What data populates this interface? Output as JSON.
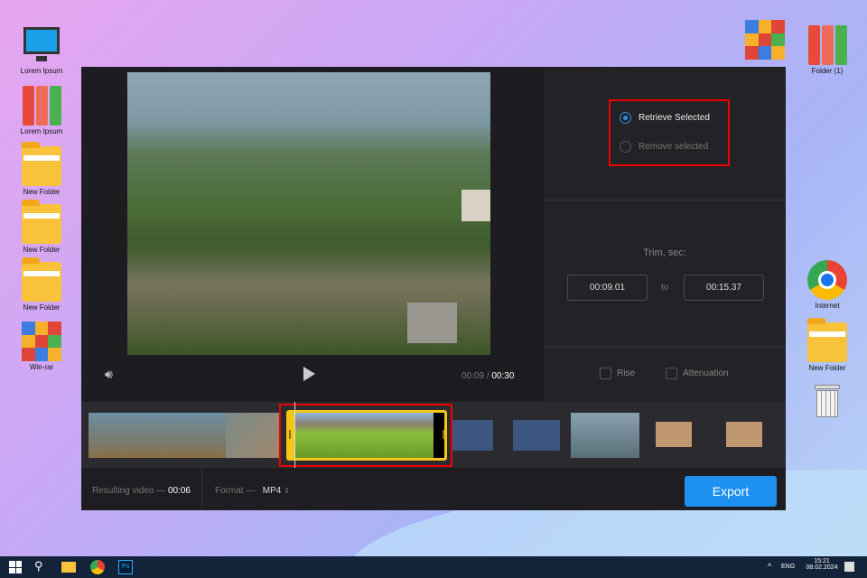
{
  "desktop": {
    "left_icons": [
      {
        "label": "Lorem Ipsum",
        "type": "computer"
      },
      {
        "label": "Lorem Ipsum",
        "type": "binders"
      },
      {
        "label": "New Folder",
        "type": "folder"
      },
      {
        "label": "New Folder",
        "type": "folder"
      },
      {
        "label": "New Folder",
        "type": "folder"
      },
      {
        "label": "Win-rar",
        "type": "winrar"
      }
    ],
    "right_icons": [
      {
        "label": "",
        "type": "winrar"
      },
      {
        "label": "Folder (1)",
        "type": "binders"
      },
      {
        "label": "Internet",
        "type": "chrome"
      },
      {
        "label": "New Folder",
        "type": "folder"
      },
      {
        "label": "",
        "type": "trash"
      }
    ]
  },
  "player": {
    "current_time": "00:09",
    "separator": "/",
    "total_time": "00:30",
    "volume_icon": "speaker-icon",
    "play_icon": "play-icon"
  },
  "options": {
    "retrieve": "Retrieve Selected",
    "remove": "Remove selected",
    "selected": "retrieve"
  },
  "trim": {
    "label": "Trim, sec:",
    "from": "00:09.01",
    "to_label": "to",
    "to": "00:15.37"
  },
  "effects": {
    "rise": "Rise",
    "attenuation": "Attenuation",
    "rise_checked": false,
    "attenuation_checked": false
  },
  "bottom": {
    "result_label": "Resulting video —",
    "result_value": "00:06",
    "format_label": "Format —",
    "format_value": "MP4",
    "export": "Export"
  },
  "colors": {
    "accent": "#1e90f0",
    "selection": "#f5c518",
    "highlight": "#e00000"
  },
  "taskbar": {
    "lang": "ENG",
    "time": "15:21",
    "date": "08.02.2024"
  }
}
